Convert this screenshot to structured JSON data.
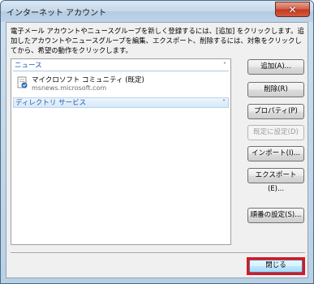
{
  "window": {
    "title": "インターネット アカウント",
    "close_glyph": "✕"
  },
  "description": "電子メール アカウントやニュースグループを新しく登録するには、[追加] をクリックします。追加したアカウントやニュースグループを編集、エクスポート、削除するには、対象をクリックしてから、希望の動作をクリックします。",
  "list": {
    "groups": [
      {
        "label": "ニュース",
        "chevron": "˄"
      },
      {
        "label": "ディレクトリ サービス",
        "chevron": "˅"
      }
    ],
    "account": {
      "icon": "newsgroup-account-icon",
      "name": "マイクロソフト コミュニティ (既定)",
      "server": "msnews.microsoft.com"
    }
  },
  "buttons": {
    "add": "追加(A)...",
    "remove": "削除(R)",
    "properties": "プロパティ(P)",
    "set_default": "既定に設定(D)",
    "import": "インポート(I)...",
    "export": "エクスポート(E)...",
    "order": "順番の設定(S)...",
    "close": "閉じる"
  },
  "colors": {
    "highlight_box": "#e0141e",
    "group_label": "#1e5aa8"
  }
}
